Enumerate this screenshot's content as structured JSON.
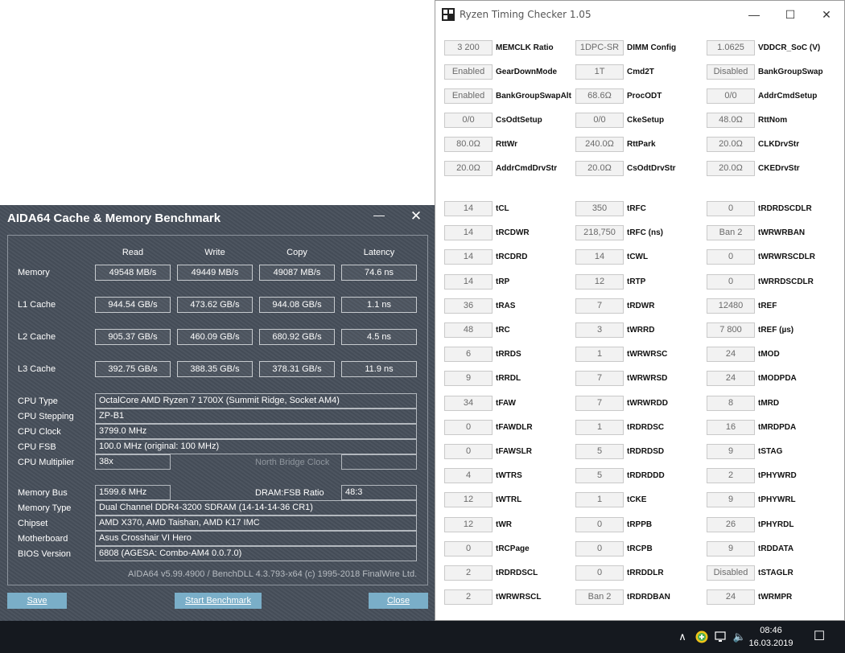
{
  "aida": {
    "title": "AIDA64 Cache & Memory Benchmark",
    "min_glyph": "—",
    "close_glyph": "✕",
    "columns": [
      "Read",
      "Write",
      "Copy",
      "Latency"
    ],
    "rows": [
      {
        "label": "Memory",
        "values": [
          "49548 MB/s",
          "49449 MB/s",
          "49087 MB/s",
          "74.6 ns"
        ]
      },
      {
        "label": "L1 Cache",
        "values": [
          "944.54 GB/s",
          "473.62 GB/s",
          "944.08 GB/s",
          "1.1 ns"
        ]
      },
      {
        "label": "L2 Cache",
        "values": [
          "905.37 GB/s",
          "460.09 GB/s",
          "680.92 GB/s",
          "4.5 ns"
        ]
      },
      {
        "label": "L3 Cache",
        "values": [
          "392.75 GB/s",
          "388.35 GB/s",
          "378.31 GB/s",
          "11.9 ns"
        ]
      }
    ],
    "info": {
      "cpu_type_label": "CPU Type",
      "cpu_type": "OctalCore AMD Ryzen 7 1700X  (Summit Ridge, Socket AM4)",
      "cpu_stepping_label": "CPU Stepping",
      "cpu_stepping": "ZP-B1",
      "cpu_clock_label": "CPU Clock",
      "cpu_clock": "3799.0 MHz",
      "cpu_fsb_label": "CPU FSB",
      "cpu_fsb": "100.0 MHz  (original: 100 MHz)",
      "cpu_multiplier_label": "CPU Multiplier",
      "cpu_multiplier": "38x",
      "north_bridge_clock_label": "North Bridge Clock",
      "north_bridge_clock": "",
      "memory_bus_label": "Memory Bus",
      "memory_bus": "1599.6 MHz",
      "dram_fsb_label": "DRAM:FSB Ratio",
      "dram_fsb": "48:3",
      "memory_type_label": "Memory Type",
      "memory_type": "Dual Channel DDR4-3200 SDRAM  (14-14-14-36 CR1)",
      "chipset_label": "Chipset",
      "chipset": "AMD X370, AMD Taishan, AMD K17 IMC",
      "motherboard_label": "Motherboard",
      "motherboard": "Asus Crosshair VI Hero",
      "bios_label": "BIOS Version",
      "bios": "6808  (AGESA: Combo-AM4 0.0.7.0)"
    },
    "version_text": "AIDA64 v5.99.4900 / BenchDLL 4.3.793-x64  (c) 1995-2018 FinalWire Ltd.",
    "buttons": {
      "save": "Save",
      "start": "Start Benchmark",
      "close": "Close"
    }
  },
  "rtc": {
    "title": "Ryzen Timing Checker 1.05",
    "win_buttons": {
      "min": "—",
      "max": "☐",
      "close": "✕"
    },
    "top_rows": [
      [
        {
          "v": "3 200",
          "l": "MEMCLK Ratio"
        },
        {
          "v": "1DPC-SR",
          "l": "DIMM Config"
        },
        {
          "v": "1.0625",
          "l": "VDDCR_SoC (V)"
        }
      ],
      [
        {
          "v": "Enabled",
          "l": "GearDownMode"
        },
        {
          "v": "1T",
          "l": "Cmd2T"
        },
        {
          "v": "Disabled",
          "l": "BankGroupSwap"
        }
      ],
      [
        {
          "v": "Enabled",
          "l": "BankGroupSwapAlt"
        },
        {
          "v": "68.6Ω",
          "l": "ProcODT"
        },
        {
          "v": "0/0",
          "l": "AddrCmdSetup"
        }
      ],
      [
        {
          "v": "0/0",
          "l": "CsOdtSetup"
        },
        {
          "v": "0/0",
          "l": "CkeSetup"
        },
        {
          "v": "48.0Ω",
          "l": "RttNom"
        }
      ],
      [
        {
          "v": "80.0Ω",
          "l": "RttWr"
        },
        {
          "v": "240.0Ω",
          "l": "RttPark"
        },
        {
          "v": "20.0Ω",
          "l": "CLKDrvStr"
        }
      ],
      [
        {
          "v": "20.0Ω",
          "l": "AddrCmdDrvStr"
        },
        {
          "v": "20.0Ω",
          "l": "CsOdtDrvStr"
        },
        {
          "v": "20.0Ω",
          "l": "CKEDrvStr"
        }
      ]
    ],
    "timing_rows": [
      [
        {
          "v": "14",
          "l": "tCL"
        },
        {
          "v": "350",
          "l": "tRFC"
        },
        {
          "v": "0",
          "l": "tRDRDSCDLR"
        }
      ],
      [
        {
          "v": "14",
          "l": "tRCDWR"
        },
        {
          "v": "218,750",
          "l": "tRFC (ns)"
        },
        {
          "v": "Ban 2",
          "l": "tWRWRBAN"
        }
      ],
      [
        {
          "v": "14",
          "l": "tRCDRD"
        },
        {
          "v": "14",
          "l": "tCWL"
        },
        {
          "v": "0",
          "l": "tWRWRSCDLR"
        }
      ],
      [
        {
          "v": "14",
          "l": "tRP"
        },
        {
          "v": "12",
          "l": "tRTP"
        },
        {
          "v": "0",
          "l": "tWRRDSCDLR"
        }
      ],
      [
        {
          "v": "36",
          "l": "tRAS"
        },
        {
          "v": "7",
          "l": "tRDWR"
        },
        {
          "v": "12480",
          "l": "tREF"
        }
      ],
      [
        {
          "v": "48",
          "l": "tRC"
        },
        {
          "v": "3",
          "l": "tWRRD"
        },
        {
          "v": "7 800",
          "l": "tREF (µs)"
        }
      ],
      [
        {
          "v": "6",
          "l": "tRRDS"
        },
        {
          "v": "1",
          "l": "tWRWRSC"
        },
        {
          "v": "24",
          "l": "tMOD"
        }
      ],
      [
        {
          "v": "9",
          "l": "tRRDL"
        },
        {
          "v": "7",
          "l": "tWRWRSD"
        },
        {
          "v": "24",
          "l": "tMODPDA"
        }
      ],
      [
        {
          "v": "34",
          "l": "tFAW"
        },
        {
          "v": "7",
          "l": "tWRWRDD"
        },
        {
          "v": "8",
          "l": "tMRD"
        }
      ],
      [
        {
          "v": "0",
          "l": "tFAWDLR"
        },
        {
          "v": "1",
          "l": "tRDRDSC"
        },
        {
          "v": "16",
          "l": "tMRDPDA"
        }
      ],
      [
        {
          "v": "0",
          "l": "tFAWSLR"
        },
        {
          "v": "5",
          "l": "tRDRDSD"
        },
        {
          "v": "9",
          "l": "tSTAG"
        }
      ],
      [
        {
          "v": "4",
          "l": "tWTRS"
        },
        {
          "v": "5",
          "l": "tRDRDDD"
        },
        {
          "v": "2",
          "l": "tPHYWRD"
        }
      ],
      [
        {
          "v": "12",
          "l": "tWTRL"
        },
        {
          "v": "1",
          "l": "tCKE"
        },
        {
          "v": "9",
          "l": "tPHYWRL"
        }
      ],
      [
        {
          "v": "12",
          "l": "tWR"
        },
        {
          "v": "0",
          "l": "tRPPB"
        },
        {
          "v": "26",
          "l": "tPHYRDL"
        }
      ],
      [
        {
          "v": "0",
          "l": "tRCPage"
        },
        {
          "v": "0",
          "l": "tRCPB"
        },
        {
          "v": "9",
          "l": "tRDDATA"
        }
      ],
      [
        {
          "v": "2",
          "l": "tRDRDSCL"
        },
        {
          "v": "0",
          "l": "tRRDDLR"
        },
        {
          "v": "Disabled",
          "l": "tSTAGLR"
        }
      ],
      [
        {
          "v": "2",
          "l": "tWRWRSCL"
        },
        {
          "v": "Ban 2",
          "l": "tRDRDBAN"
        },
        {
          "v": "24",
          "l": "tWRMPR"
        }
      ]
    ]
  },
  "taskbar": {
    "time": "08:46",
    "date": "16.03.2019",
    "chevron_glyph": "∧",
    "volume_glyph": "🔈",
    "notification_glyph": "☐"
  }
}
